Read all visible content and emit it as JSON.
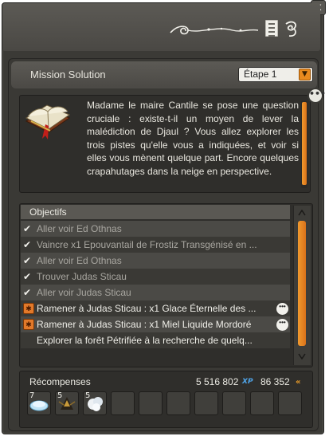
{
  "window": {
    "close_label": "x"
  },
  "header": {
    "title": "Mission Solution",
    "step_select": {
      "value": "Étape 1"
    }
  },
  "description": "Madame le maire Cantile se pose une question cruciale : existe-t-il un moyen de lever la malédiction de Djaul ? Vous allez explorer les trois pistes qu'elle vous a indiquées, et voir si elles vous mènent quelque part. Encore quelques crapahutages dans la neige en perspective.",
  "objectives": {
    "label": "Objectifs",
    "items": [
      {
        "text": "Aller voir Ed Othnas",
        "done": true
      },
      {
        "text": "Vaincre x1 Epouvantail de Frostiz Transgénisé en ...",
        "done": true
      },
      {
        "text": "Aller voir Ed Othnas",
        "done": true
      },
      {
        "text": "Trouver Judas Sticau",
        "done": true
      },
      {
        "text": "Aller voir Judas Sticau",
        "done": true
      },
      {
        "text": "Ramener à Judas Sticau : x1 Glace Éternelle des ...",
        "done": false,
        "has_more": true
      },
      {
        "text": "Ramener à Judas Sticau : x1 Miel Liquide Mordoré",
        "done": false,
        "has_more": true
      },
      {
        "text": "Explorer la forêt Pétrifiée à la recherche de quelq...",
        "done": false,
        "has_more": false
      }
    ]
  },
  "rewards": {
    "label": "Récompenses",
    "xp": "5 516 802",
    "xp_tag": "XP",
    "kamas": "86 352",
    "items": [
      {
        "qty": "7",
        "icon": "ice-disc-icon"
      },
      {
        "qty": "5",
        "icon": "dark-bug-icon"
      },
      {
        "qty": "5",
        "icon": "white-fluff-icon"
      },
      {
        "qty": "",
        "icon": "empty-slot"
      },
      {
        "qty": "",
        "icon": "empty-slot"
      },
      {
        "qty": "",
        "icon": "empty-slot"
      },
      {
        "qty": "",
        "icon": "empty-slot"
      },
      {
        "qty": "",
        "icon": "empty-slot"
      },
      {
        "qty": "",
        "icon": "empty-slot"
      },
      {
        "qty": "",
        "icon": "empty-slot"
      }
    ]
  },
  "colors": {
    "accent": "#e98a1e",
    "xp": "#4fa3e6",
    "panel": "#3a3935"
  }
}
